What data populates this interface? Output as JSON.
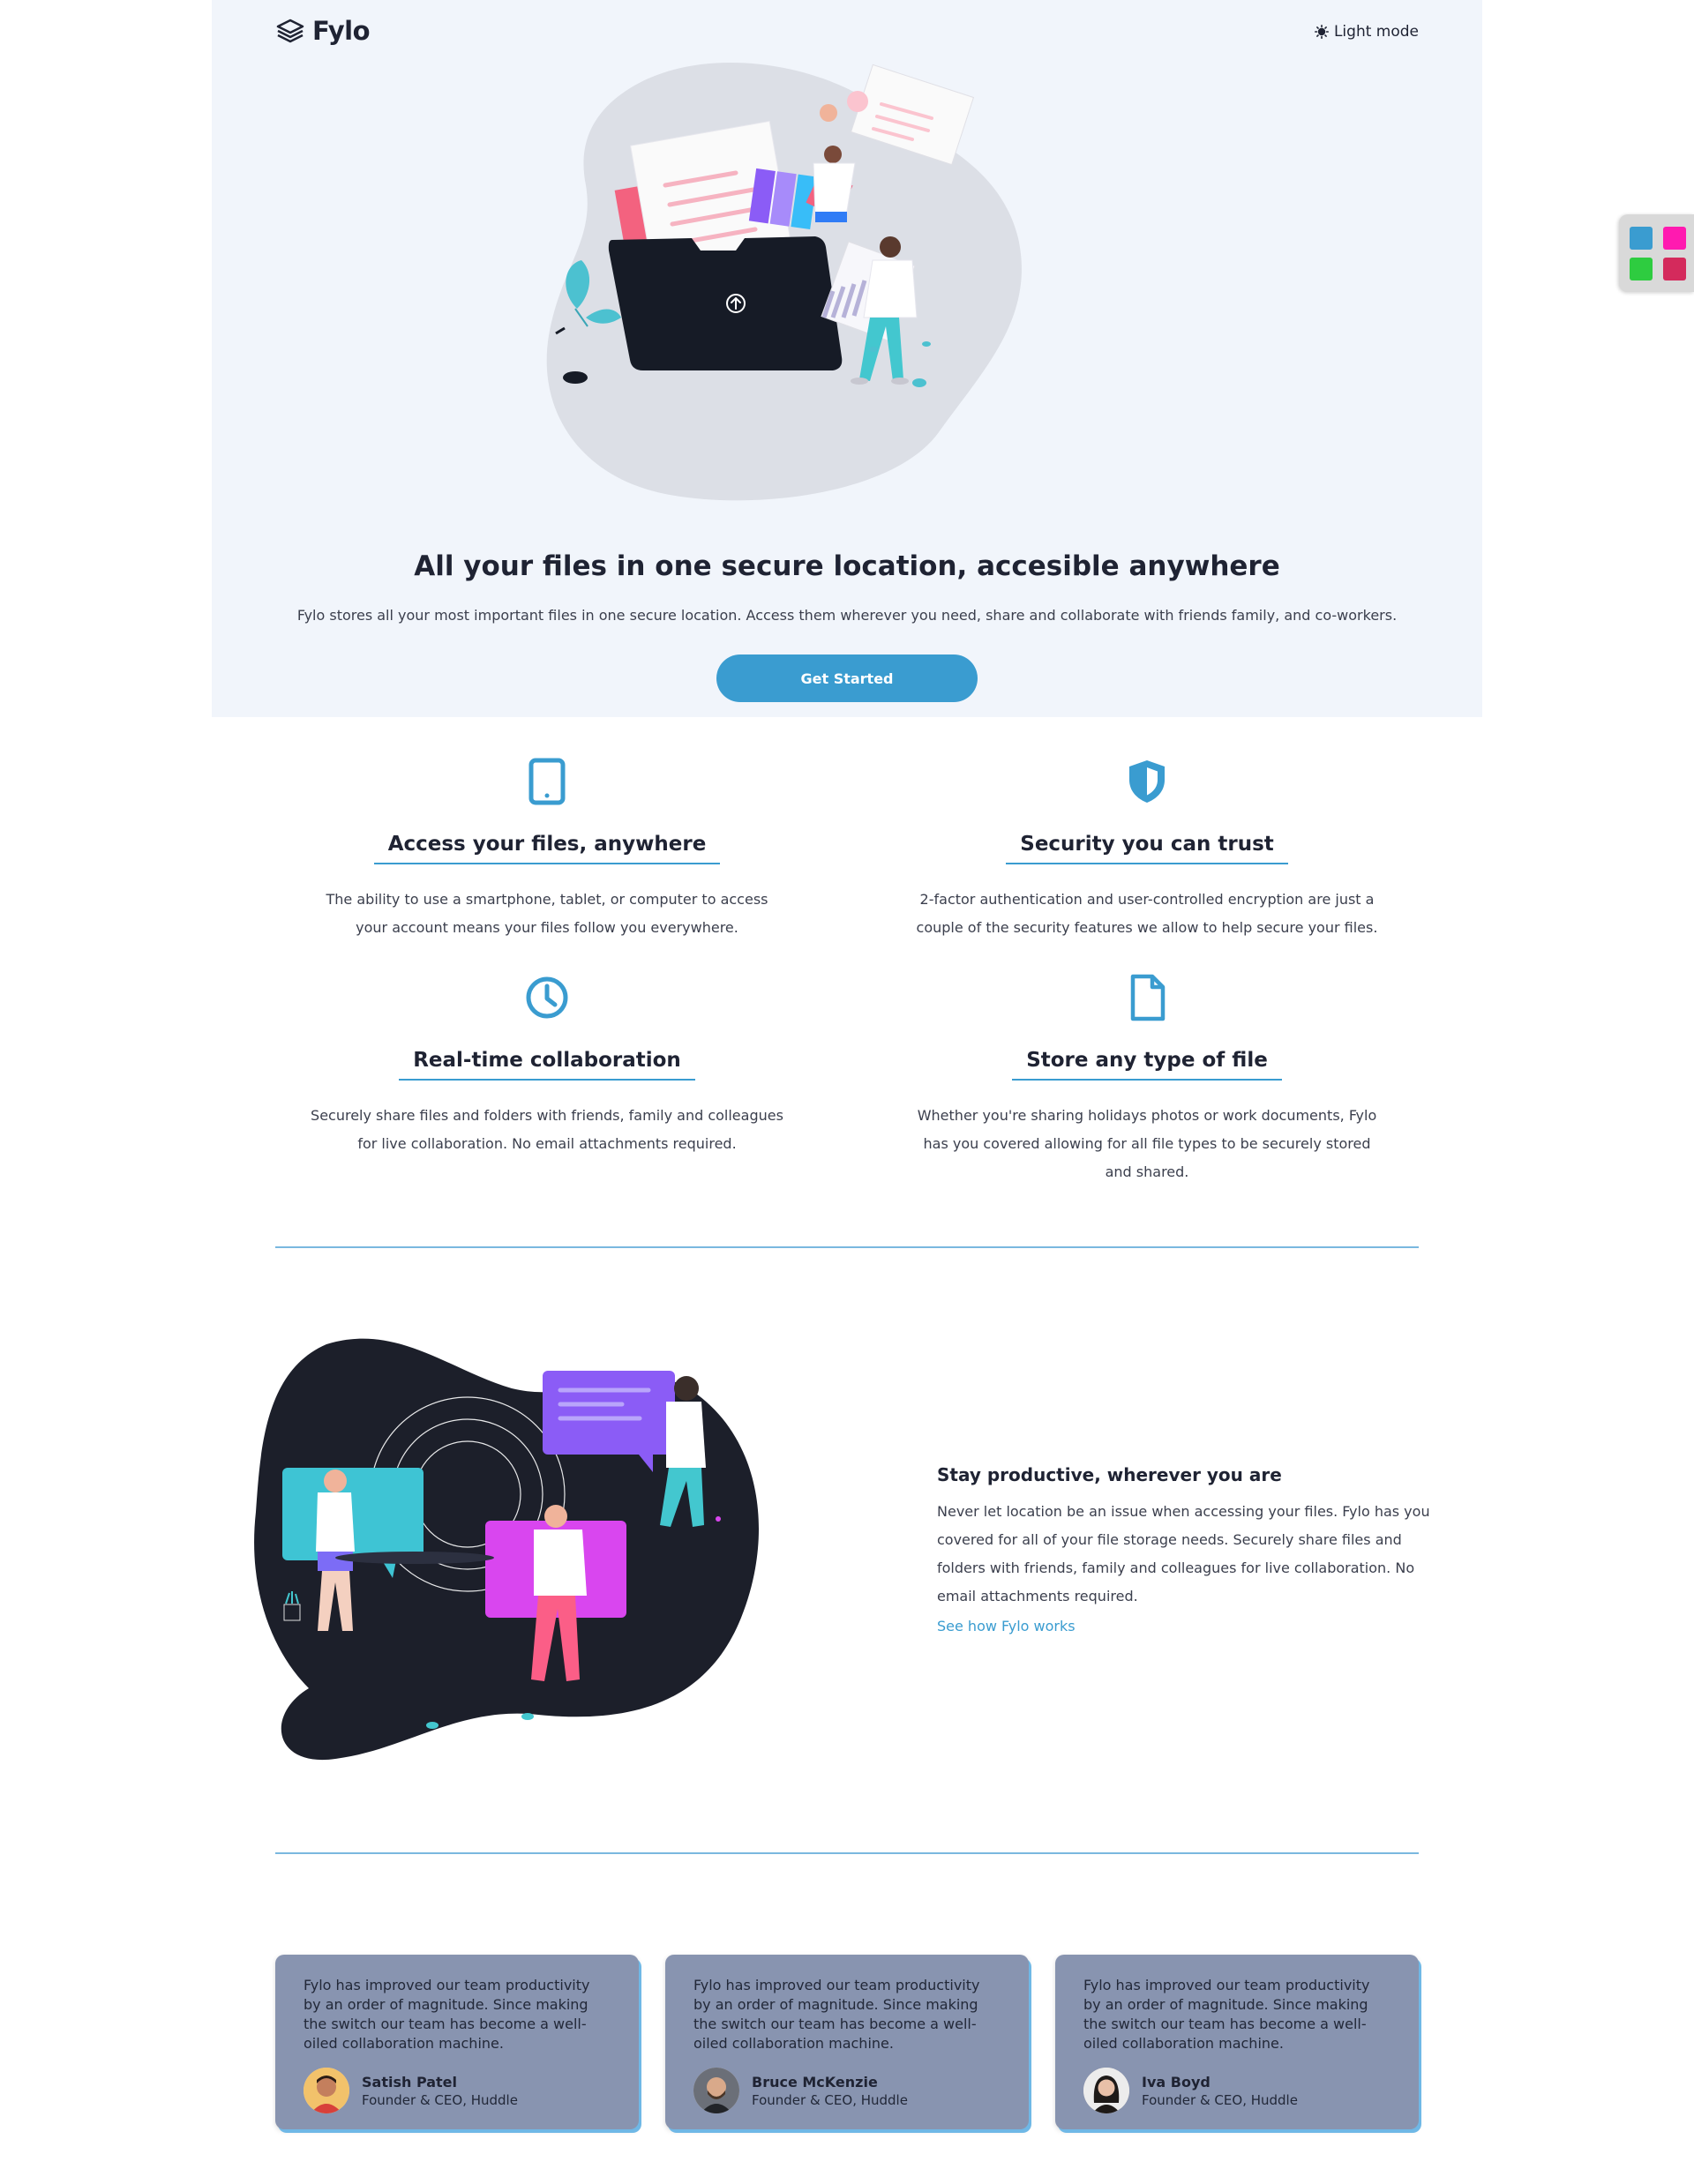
{
  "header": {
    "logo_text": "Fylo",
    "mode_label": "Light mode"
  },
  "hero": {
    "title": "All your files in one secure location, accesible anywhere",
    "subtitle": "Fylo stores all your most important files in one secure location. Access them wherever you need, share and collaborate with friends family, and co-workers.",
    "cta_label": "Get Started"
  },
  "features": [
    {
      "icon": "tablet-icon",
      "title": "Access your files, anywhere",
      "text": "The ability to use a smartphone, tablet, or computer to access your account means your files follow you everywhere."
    },
    {
      "icon": "shield-icon",
      "title": "Security you can trust",
      "text": "2-factor authentication and user-controlled encryption are just a couple of the security features we allow to help secure your files."
    },
    {
      "icon": "clock-icon",
      "title": "Real-time collaboration",
      "text": "Securely share files and folders with friends, family and colleagues for live collaboration. No email attachments required."
    },
    {
      "icon": "file-icon",
      "title": "Store any type of file",
      "text": "Whether you're sharing holidays photos or work documents, Fylo has you covered allowing for all file types to be securely stored and shared."
    }
  ],
  "productive": {
    "title": "Stay productive, wherever you are",
    "text": "Never let location be an issue when accessing your files. Fylo has you covered for all of your file storage needs. Securely share files and folders with friends, family and colleagues for live collaboration. No email attachments required.",
    "link_label": "See how Fylo works"
  },
  "testimonials": [
    {
      "quote": "Fylo has improved our team productivity by an order of magnitude. Since making the switch our team has become a well-oiled collaboration machine.",
      "name": "Satish Patel",
      "role": "Founder & CEO, Huddle"
    },
    {
      "quote": "Fylo has improved our team productivity by an order of magnitude. Since making the switch our team has become a well-oiled collaboration machine.",
      "name": "Bruce McKenzie",
      "role": "Founder & CEO, Huddle"
    },
    {
      "quote": "Fylo has improved our team productivity by an order of magnitude. Since making the switch our team has become a well-oiled collaboration machine.",
      "name": "Iva Boyd",
      "role": "Founder & CEO, Huddle"
    }
  ],
  "theme_swatches": [
    "#3a9cd0",
    "#ff1ab0",
    "#2ecc40",
    "#d42a5c"
  ],
  "colors": {
    "accent": "#3a9cd0",
    "hero_bg": "#f1f5fb",
    "card_bg": "#8894b0",
    "text_dark": "#1f2333"
  }
}
